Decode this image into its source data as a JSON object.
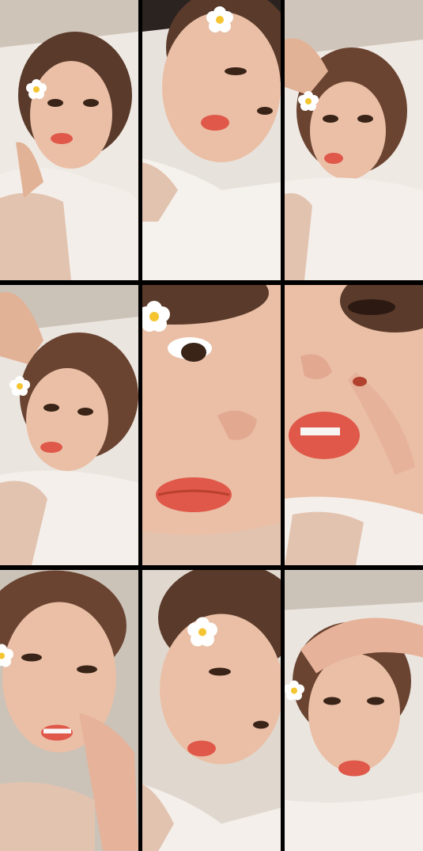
{
  "collage": {
    "tiles": [
      {
        "subject": "selfie-with-flower",
        "has_flower": true
      },
      {
        "subject": "selfie-closeup-with-flower",
        "has_flower": true
      },
      {
        "subject": "selfie-with-flower",
        "has_flower": true
      },
      {
        "subject": "selfie-hand-in-hair",
        "has_flower": true
      },
      {
        "subject": "extreme-closeup-face",
        "has_flower": true
      },
      {
        "subject": "closeup-finger-on-nose",
        "has_flower": false
      },
      {
        "subject": "selfie-finger-on-nose",
        "has_flower": true
      },
      {
        "subject": "selfie-tilted-with-flower",
        "has_flower": true
      },
      {
        "subject": "selfie-hand-on-head",
        "has_flower": true
      }
    ],
    "colors": {
      "divider": "#000000",
      "skin": "#eabfa6",
      "hair": "#5a3a2a",
      "blouse": "#f2ece6",
      "lace": "#e2c3b0",
      "lips": "#e0584a",
      "flower_petal": "#ffffff",
      "flower_center": "#f4c531"
    }
  }
}
